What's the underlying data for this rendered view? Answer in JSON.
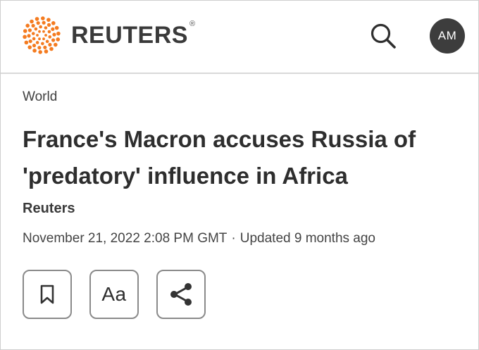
{
  "header": {
    "logo_text": "REUTERS",
    "logo_reg_mark": "®",
    "brand_color": "#f47b20",
    "search_icon": "search-icon",
    "avatar_initials": "AM"
  },
  "article": {
    "section": "World",
    "headline": "France's Macron accuses Russia of 'predatory' influence in Africa",
    "byline": "Reuters",
    "published": "November 21, 2022 2:08 PM GMT",
    "separator": "·",
    "updated": "Updated 9 months ago"
  },
  "actions": {
    "bookmark_icon": "bookmark-icon",
    "text_size_label": "Aa",
    "share_icon": "share-icon"
  }
}
